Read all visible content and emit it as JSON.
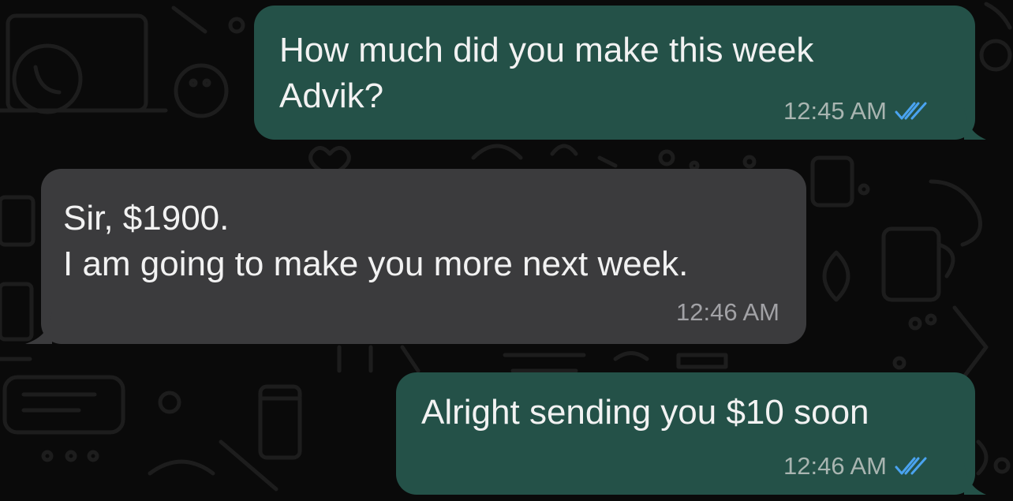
{
  "messages": [
    {
      "direction": "outgoing",
      "text": "How much did you make this week\nAdvik?",
      "time": "12:45 AM",
      "status_icon": "double-check-read-icon"
    },
    {
      "direction": "incoming",
      "text": "Sir, $1900.\nI am going to make you more next week.",
      "time": "12:46 AM"
    },
    {
      "direction": "outgoing",
      "text": "Alright sending you $10 soon",
      "time": "12:46 AM",
      "status_icon": "double-check-read-icon"
    }
  ],
  "colors": {
    "background": "#0a0a0a",
    "outgoing_bubble": "#245148",
    "incoming_bubble": "#3b3b3d",
    "read_ticks": "#4aa3f0",
    "doodle_stroke": "#1c1c1c"
  }
}
